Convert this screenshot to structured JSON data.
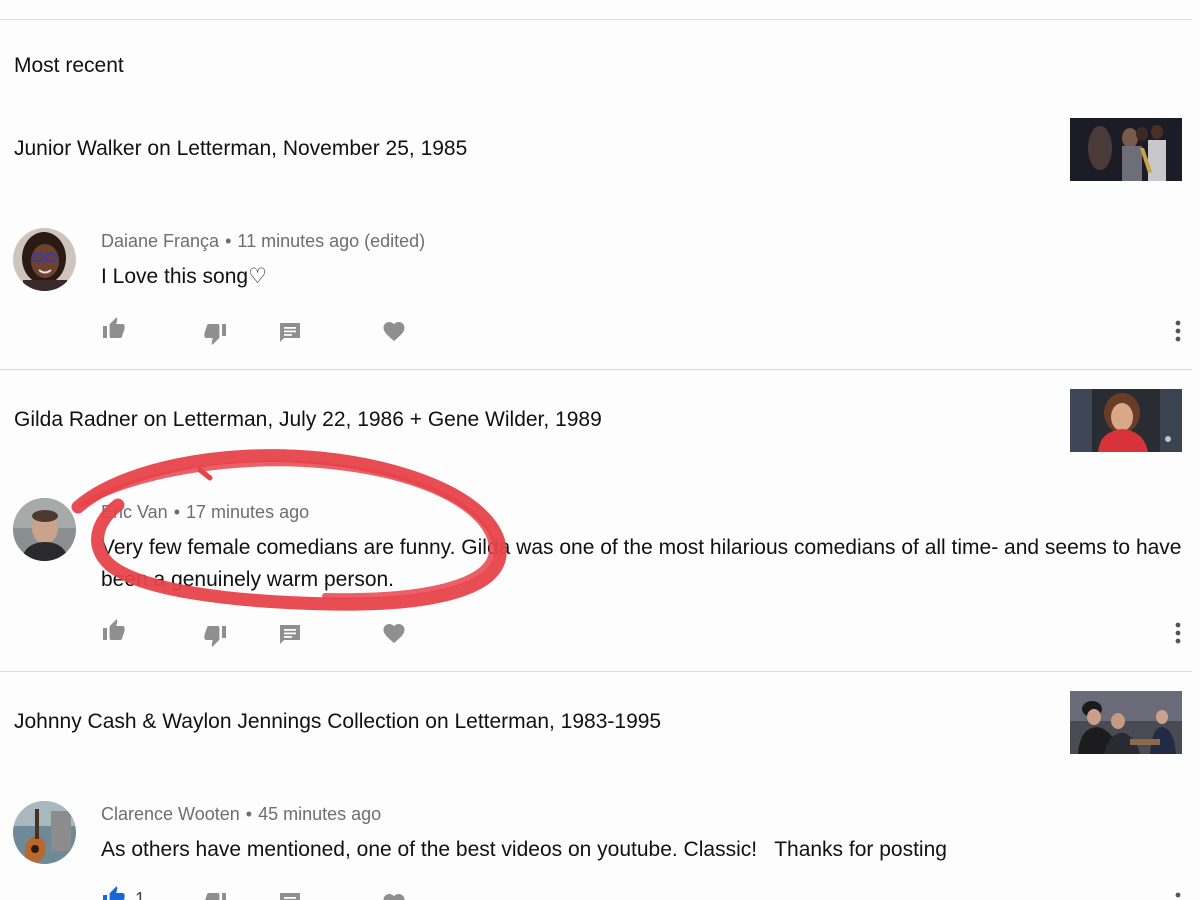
{
  "feed": {
    "filter_label": "Most recent"
  },
  "items": [
    {
      "video_title": "Junior Walker on Letterman, November 25, 1985",
      "thumbnail_icon": "video-thumbnail",
      "comment": {
        "author": "Daiane França",
        "separator": "•",
        "time": "11 minutes ago (edited)",
        "text": "I Love this song♡"
      }
    },
    {
      "video_title": "Gilda Radner on Letterman, July 22, 1986 + Gene Wilder, 1989",
      "thumbnail_icon": "video-thumbnail",
      "comment": {
        "author": "Eric Van",
        "separator": "•",
        "time": "17 minutes ago",
        "text": "Very few female comedians are funny. Gilda was one of the most hilarious comedians of all time- and seems to have been a genuinely warm person."
      }
    },
    {
      "video_title": "Johnny Cash & Waylon Jennings Collection on Letterman, 1983-1995",
      "thumbnail_icon": "video-thumbnail",
      "comment": {
        "author": "Clarence Wooten",
        "separator": "•",
        "time": "45 minutes ago",
        "text": "As others have mentioned, one of the best videos on youtube. Classic!   Thanks for posting",
        "like_count": "1"
      }
    }
  ],
  "icons": {
    "like": "thumbs-up-icon",
    "dislike": "thumbs-down-icon",
    "reply": "comment-icon",
    "heart": "heart-icon",
    "more": "more-vertical-icon"
  },
  "colors": {
    "annotation": "#e8434b",
    "like_active": "#1a66d6",
    "icon": "#8f8f8f",
    "meta_text": "#6e6e6e"
  }
}
